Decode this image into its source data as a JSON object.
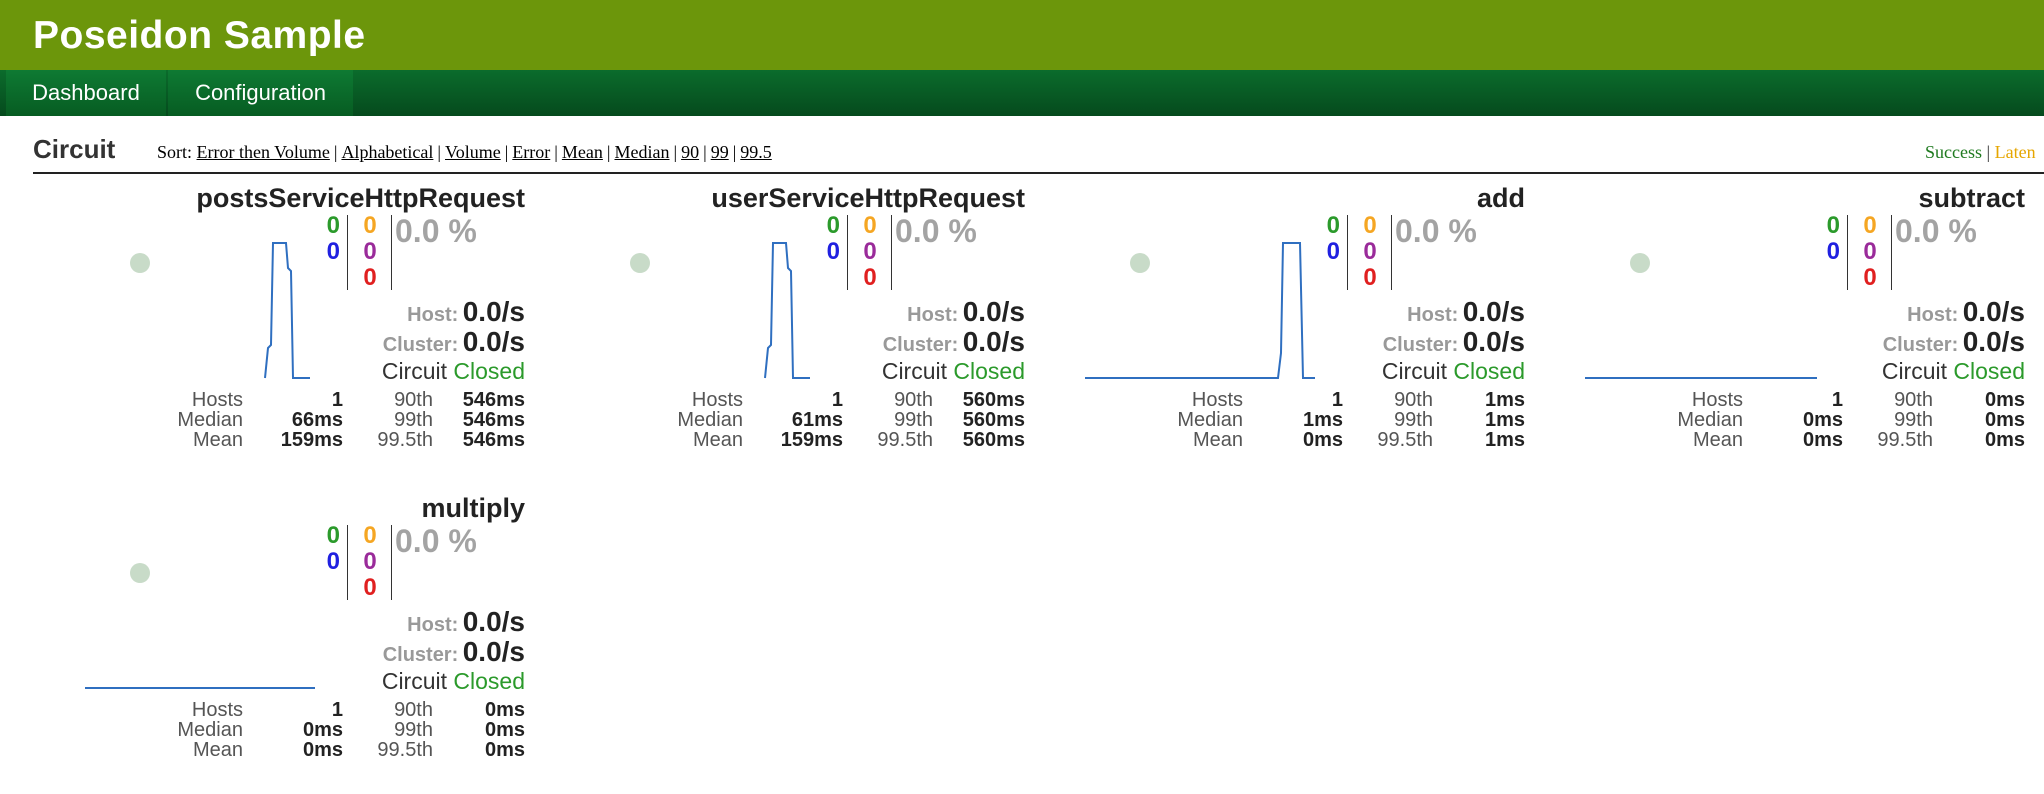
{
  "header": {
    "title": "Poseidon Sample"
  },
  "nav": {
    "tabs": [
      {
        "label": "Dashboard"
      },
      {
        "label": "Configuration"
      }
    ]
  },
  "section": {
    "title": "Circuit",
    "sort_prefix": "Sort:",
    "sort_options": [
      "Error then Volume",
      "Alphabetical",
      "Volume",
      "Error",
      "Mean",
      "Median",
      "90",
      "99",
      "99.5"
    ],
    "sort_separator": "|"
  },
  "legend": {
    "items": [
      {
        "label": "Success",
        "color": "#1f7a1f"
      },
      {
        "label": "Laten",
        "color": "#e6a600"
      }
    ],
    "separator": "|"
  },
  "colors": {
    "success": "#2b9a2b",
    "short_circuited": "#2020e0",
    "timeout": "#f5a623",
    "rejected": "#9a2b9a",
    "failure": "#e02020",
    "spark_line": "#2f6fc0",
    "header_bg": "#6c960b",
    "nav_bg": "#0b6c2c"
  },
  "labels": {
    "host": "Host:",
    "cluster": "Cluster:",
    "circuit": "Circuit",
    "hosts": "Hosts",
    "median": "Median",
    "mean": "Mean",
    "p90": "90th",
    "p99": "99th",
    "p995": "99.5th"
  },
  "circuits": [
    {
      "name": "postsServiceHttpRequest",
      "success": "0",
      "short_circuited": "0",
      "timeout": "0",
      "rejected": "0",
      "failure": "0",
      "error_pct": "0.0 %",
      "host_rate": "0.0/s",
      "cluster_rate": "0.0/s",
      "state": "Closed",
      "hosts": "1",
      "median": "66ms",
      "mean": "159ms",
      "p90": "546ms",
      "p99": "546ms",
      "p995": "546ms"
    },
    {
      "name": "userServiceHttpRequest",
      "success": "0",
      "short_circuited": "0",
      "timeout": "0",
      "rejected": "0",
      "failure": "0",
      "error_pct": "0.0 %",
      "host_rate": "0.0/s",
      "cluster_rate": "0.0/s",
      "state": "Closed",
      "hosts": "1",
      "median": "61ms",
      "mean": "159ms",
      "p90": "560ms",
      "p99": "560ms",
      "p995": "560ms"
    },
    {
      "name": "add",
      "success": "0",
      "short_circuited": "0",
      "timeout": "0",
      "rejected": "0",
      "failure": "0",
      "error_pct": "0.0 %",
      "host_rate": "0.0/s",
      "cluster_rate": "0.0/s",
      "state": "Closed",
      "hosts": "1",
      "median": "1ms",
      "mean": "0ms",
      "p90": "1ms",
      "p99": "1ms",
      "p995": "1ms"
    },
    {
      "name": "subtract",
      "success": "0",
      "short_circuited": "0",
      "timeout": "0",
      "rejected": "0",
      "failure": "0",
      "error_pct": "0.0 %",
      "host_rate": "0.0/s",
      "cluster_rate": "0.0/s",
      "state": "Closed",
      "hosts": "1",
      "median": "0ms",
      "mean": "0ms",
      "p90": "0ms",
      "p99": "0ms",
      "p995": "0ms"
    },
    {
      "name": "multiply",
      "success": "0",
      "short_circuited": "0",
      "timeout": "0",
      "rejected": "0",
      "failure": "0",
      "error_pct": "0.0 %",
      "host_rate": "0.0/s",
      "cluster_rate": "0.0/s",
      "state": "Closed",
      "hosts": "1",
      "median": "0ms",
      "mean": "0ms",
      "p90": "0ms",
      "p99": "0ms",
      "p995": "0ms"
    }
  ]
}
